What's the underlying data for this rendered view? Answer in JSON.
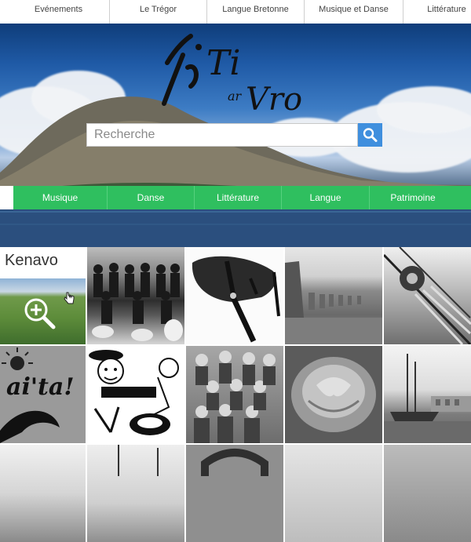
{
  "topnav": {
    "items": [
      "Evénements",
      "Le Trégor",
      "Langue Bretonne",
      "Musique et Danse",
      "Littérature"
    ]
  },
  "logo": {
    "text_top": "Ti",
    "text_small": "ar",
    "text_bottom": "Vro"
  },
  "search": {
    "placeholder": "Recherche",
    "icon": "magnifier-icon"
  },
  "categories": [
    "Musique",
    "Danse",
    "Littérature",
    "Langue",
    "Patrimoine"
  ],
  "colors": {
    "accent_green": "#2fbf5f",
    "search_blue": "#3f8fde"
  },
  "grid": {
    "featured_title": "Kenavo",
    "logo_text": "ai'ta!"
  }
}
